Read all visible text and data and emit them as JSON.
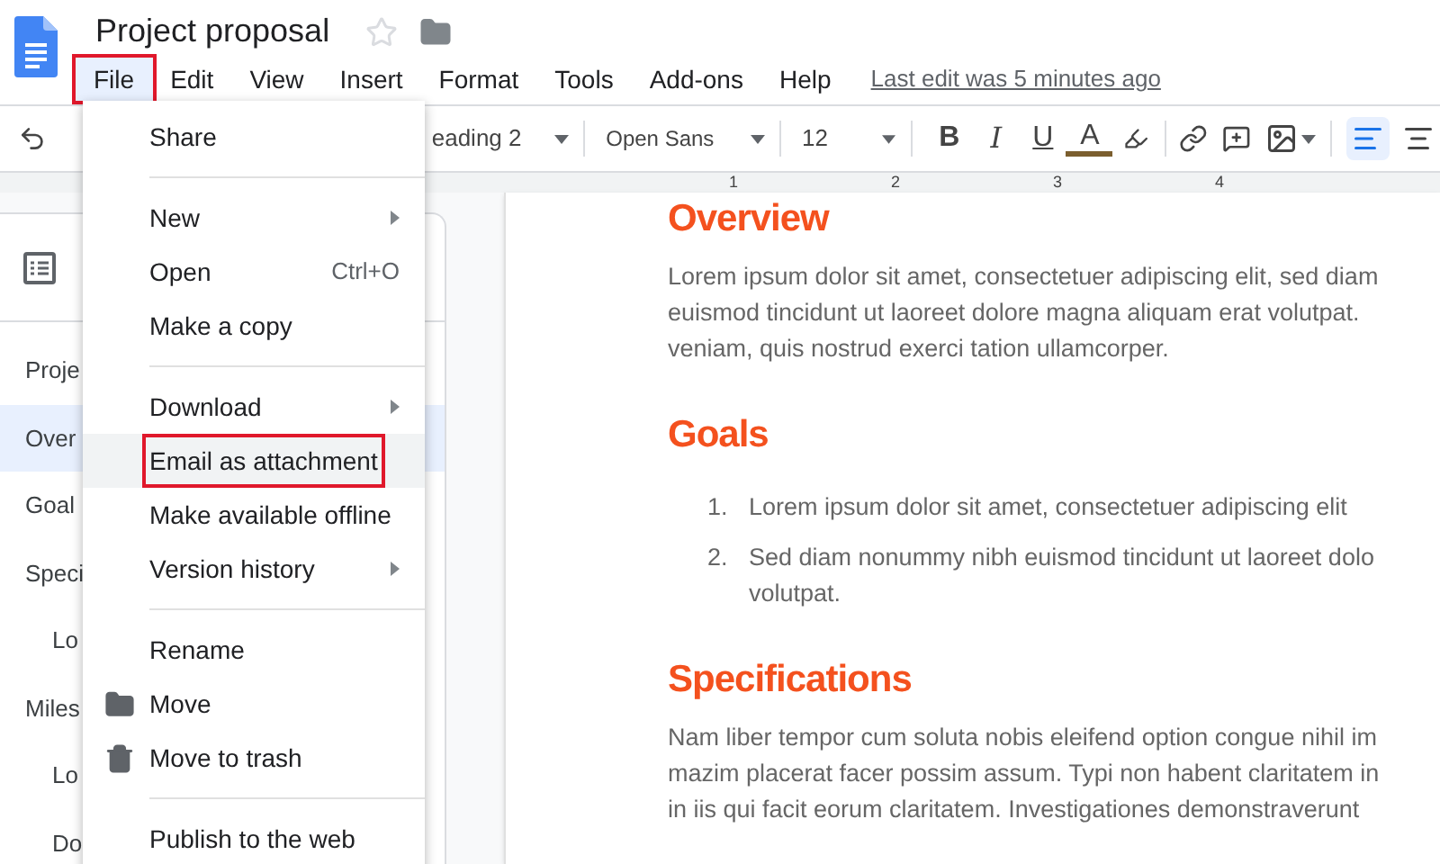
{
  "title": "Project proposal",
  "starred": false,
  "menubar": [
    {
      "label": "File",
      "selected": true
    },
    {
      "label": "Edit",
      "selected": false
    },
    {
      "label": "View",
      "selected": false
    },
    {
      "label": "Insert",
      "selected": false
    },
    {
      "label": "Format",
      "selected": false
    },
    {
      "label": "Tools",
      "selected": false
    },
    {
      "label": "Add-ons",
      "selected": false
    },
    {
      "label": "Help",
      "selected": false
    }
  ],
  "last_edit": "Last edit was 5 minutes ago",
  "toolbar": {
    "style": "eading 2",
    "font": "Open Sans",
    "size": "12",
    "format_buttons": [
      {
        "kind": "bold",
        "label": "B"
      },
      {
        "kind": "italic",
        "label": "I"
      },
      {
        "kind": "underline",
        "label": "U"
      },
      {
        "kind": "text_color",
        "label": "A"
      }
    ],
    "alignment": [
      {
        "kind": "left",
        "selected": true
      },
      {
        "kind": "center",
        "selected": false
      }
    ]
  },
  "ruler": [
    "1",
    "2",
    "3",
    "4"
  ],
  "outline": {
    "items": [
      {
        "label": "Proje",
        "selected": false
      },
      {
        "label": "Over",
        "selected": true
      },
      {
        "label": "Goal",
        "selected": false
      },
      {
        "label": "Speci",
        "selected": false,
        "children": [
          {
            "label": "Lo",
            "selected": false
          }
        ]
      },
      {
        "label": "Miles",
        "selected": false,
        "children": [
          {
            "label": "Lo",
            "selected": false
          },
          {
            "label": "Do",
            "selected": false
          }
        ]
      }
    ]
  },
  "file_menu": [
    [
      {
        "label": "Share",
        "submenu": false,
        "highlighted": false
      }
    ],
    [
      {
        "label": "New",
        "submenu": true,
        "highlighted": false
      },
      {
        "label": "Open",
        "shortcut": "Ctrl+O",
        "submenu": false,
        "highlighted": false
      },
      {
        "label": "Make a copy",
        "submenu": false,
        "highlighted": false
      }
    ],
    [
      {
        "label": "Download",
        "submenu": true,
        "highlighted": false
      },
      {
        "label": "Email as attachment",
        "submenu": false,
        "highlighted": true
      },
      {
        "label": "Make available offline",
        "submenu": false,
        "highlighted": false
      },
      {
        "label": "Version history",
        "submenu": true,
        "highlighted": false
      }
    ],
    [
      {
        "label": "Rename",
        "submenu": false,
        "highlighted": false
      },
      {
        "label": "Move",
        "submenu": false,
        "highlighted": false
      },
      {
        "label": "Move to trash",
        "submenu": false,
        "highlighted": false
      }
    ],
    [
      {
        "label": "Publish to the web",
        "submenu": false,
        "highlighted": false
      }
    ]
  ],
  "document": [
    {
      "kind": "paragraph",
      "heading": "Overview",
      "lines": [
        "Lorem ipsum dolor sit amet, consectetuer adipiscing elit, sed diam",
        "euismod tincidunt ut laoreet dolore magna aliquam erat volutpat.",
        "veniam, quis nostrud exerci tation ullamcorper."
      ]
    },
    {
      "kind": "list",
      "heading": "Goals",
      "items": [
        {
          "number": "1.",
          "lines": [
            "Lorem ipsum dolor sit amet, consectetuer adipiscing elit"
          ]
        },
        {
          "number": "2.",
          "lines": [
            "Sed diam nonummy nibh euismod tincidunt ut laoreet dolo",
            "volutpat."
          ]
        }
      ]
    },
    {
      "kind": "paragraph",
      "heading": "Specifications",
      "lines": [
        "Nam liber tempor cum soluta nobis eleifend option congue nihil im",
        "mazim placerat facer possim assum. Typi non habent claritatem in",
        "in iis qui facit eorum claritatem. Investigationes demonstraverunt"
      ]
    }
  ]
}
